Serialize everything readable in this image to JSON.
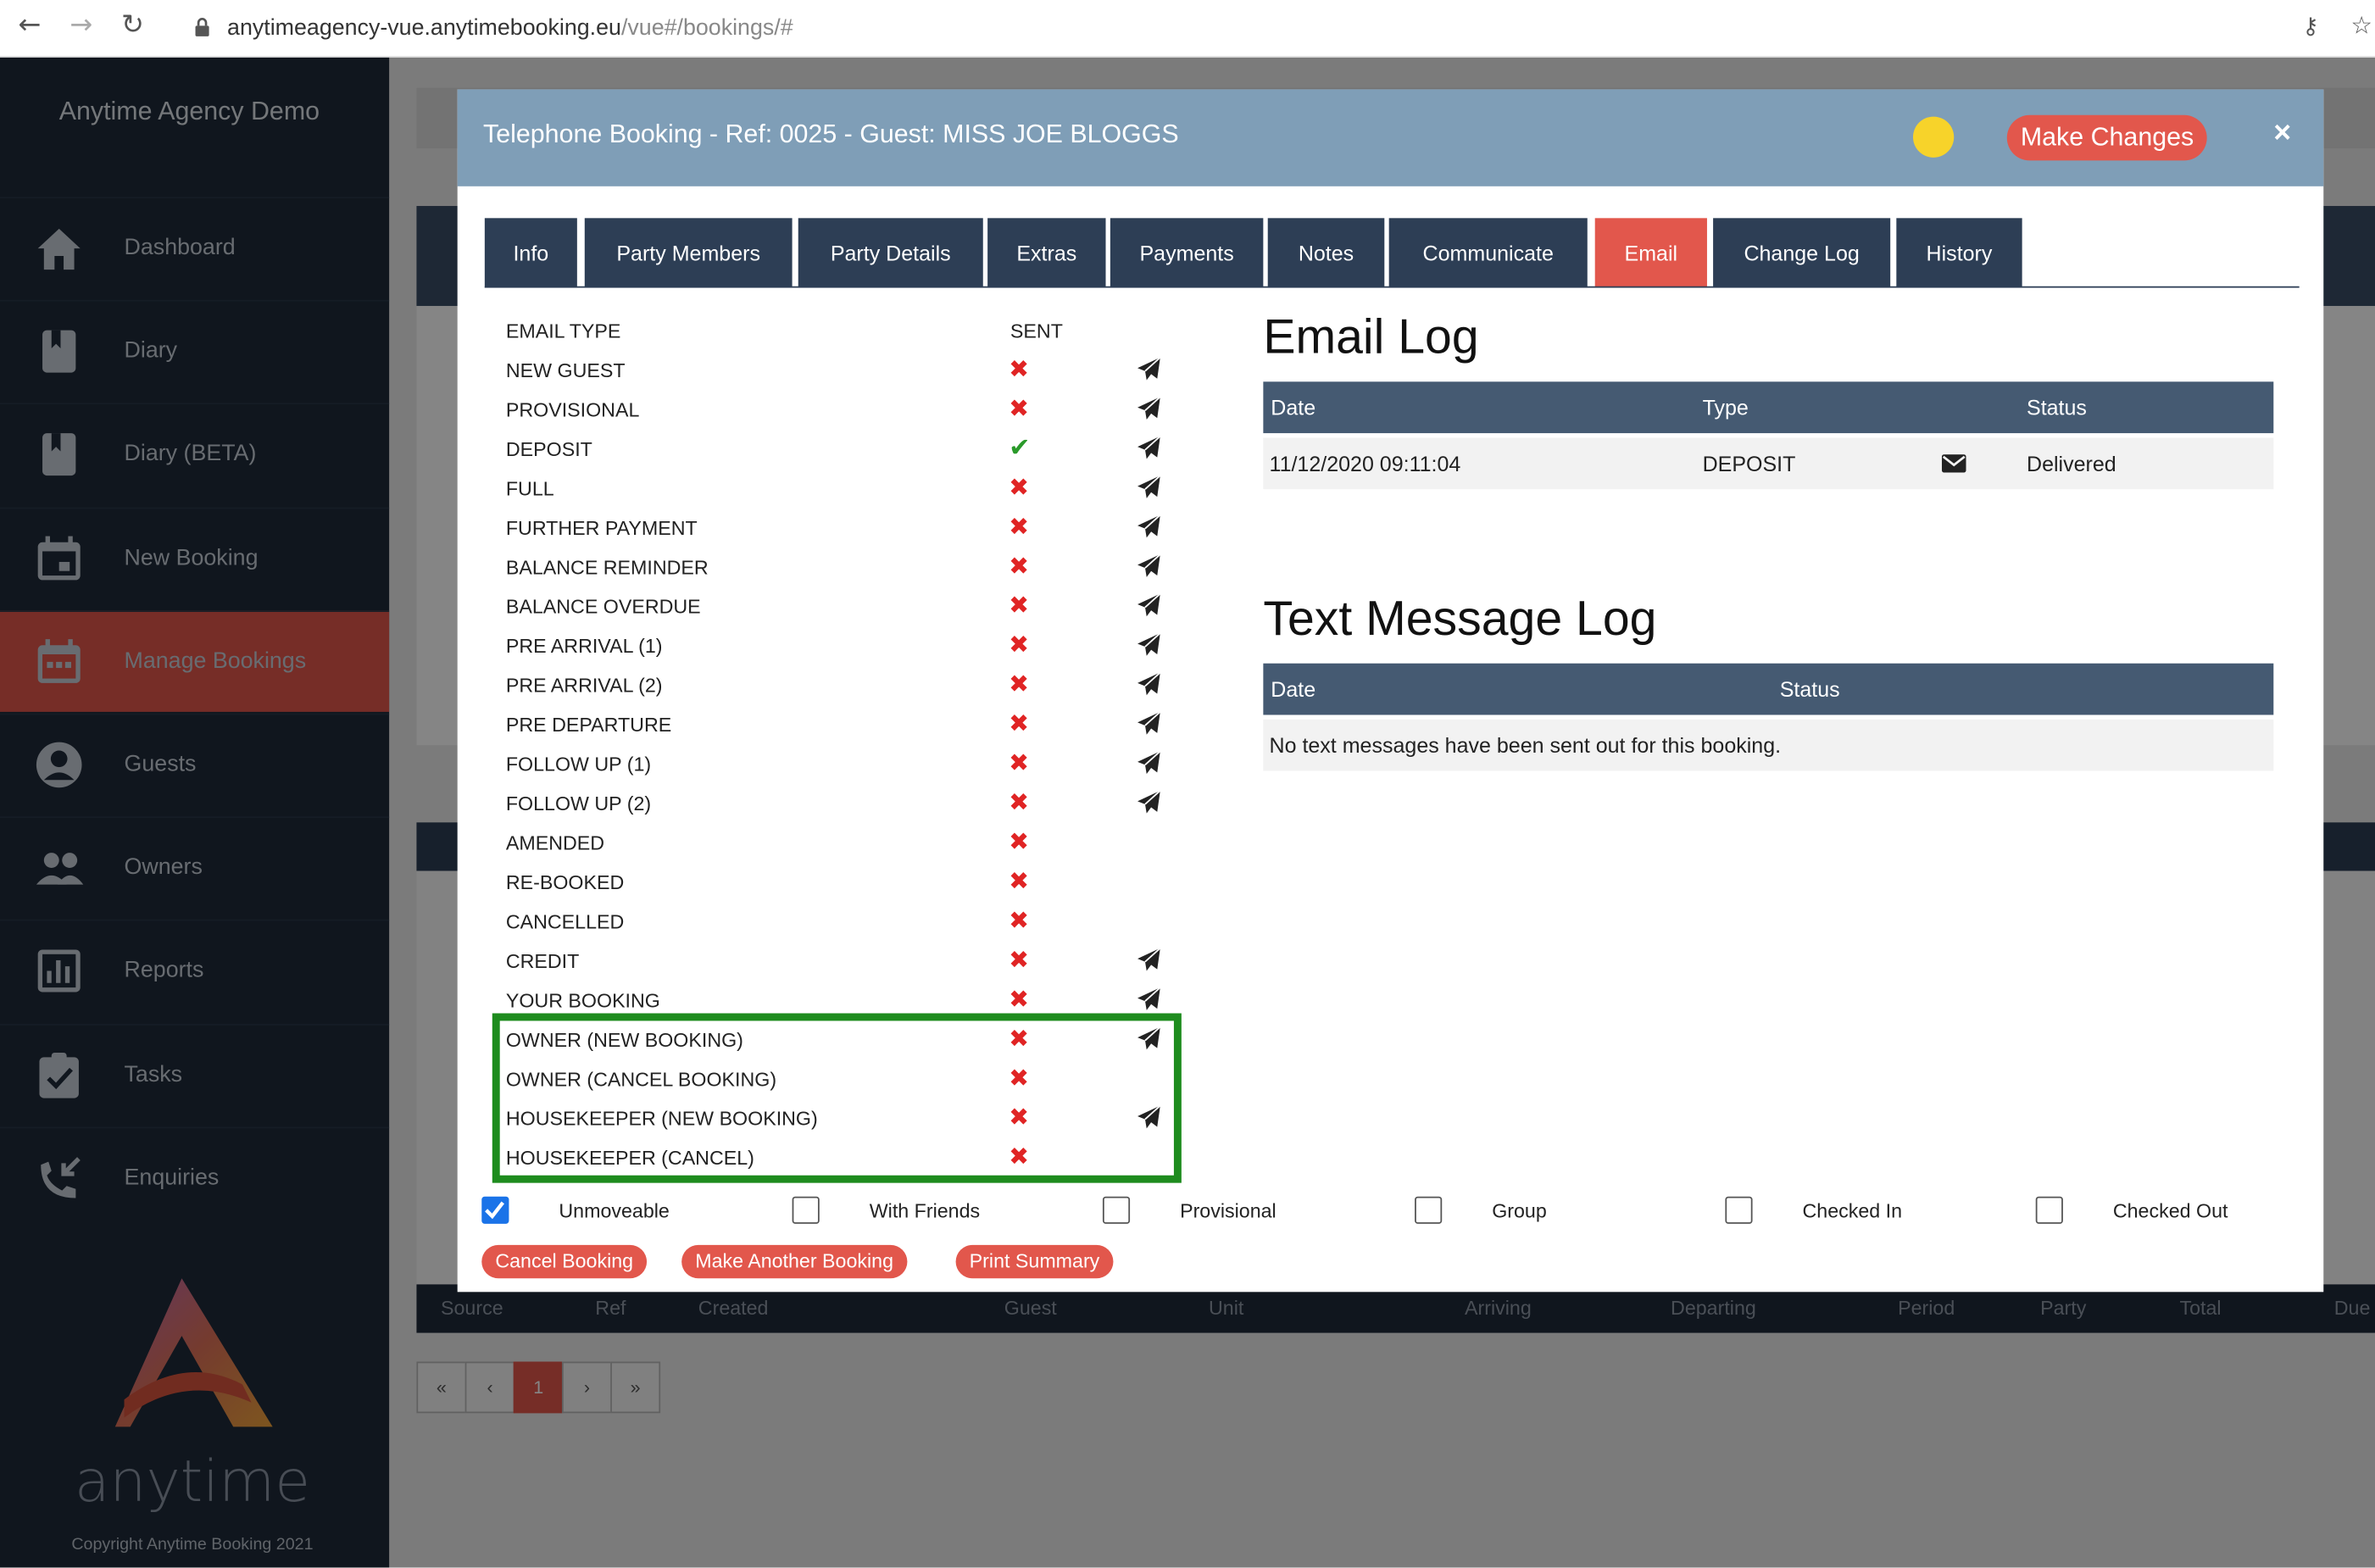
{
  "browser": {
    "url_host": "anytimeagency-vue.anytimebooking.eu",
    "url_path": "/vue#/bookings/#"
  },
  "sidebar": {
    "brand": "Anytime Agency Demo",
    "items": [
      {
        "label": "Dashboard",
        "icon": "home-icon"
      },
      {
        "label": "Diary",
        "icon": "bookmark-icon"
      },
      {
        "label": "Diary (BETA)",
        "icon": "bookmark-icon"
      },
      {
        "label": "New Booking",
        "icon": "calendar-icon"
      },
      {
        "label": "Manage Bookings",
        "icon": "calendar-dots-icon",
        "active": true
      },
      {
        "label": "Guests",
        "icon": "account-icon"
      },
      {
        "label": "Owners",
        "icon": "people-icon"
      },
      {
        "label": "Reports",
        "icon": "chart-icon"
      },
      {
        "label": "Tasks",
        "icon": "clipboard-check-icon"
      },
      {
        "label": "Enquiries",
        "icon": "phone-incoming-icon"
      }
    ],
    "logo_text": "anytime",
    "copyright": "Copyright Anytime Booking 2021"
  },
  "modal": {
    "title": "Telephone Booking - Ref: 0025 - Guest: MISS JOE BLOGGS",
    "make_changes": "Make Changes",
    "close": "×",
    "tabs": [
      "Info",
      "Party Members",
      "Party Details",
      "Extras",
      "Payments",
      "Notes",
      "Communicate",
      "Email",
      "Change Log",
      "History"
    ],
    "active_tab": "Email",
    "email_types_header": "EMAIL TYPE",
    "sent_header": "SENT",
    "email_types": [
      {
        "name": "NEW GUEST",
        "sent": false,
        "sendable": true
      },
      {
        "name": "PROVISIONAL",
        "sent": false,
        "sendable": true
      },
      {
        "name": "DEPOSIT",
        "sent": true,
        "sendable": true
      },
      {
        "name": "FULL",
        "sent": false,
        "sendable": true
      },
      {
        "name": "FURTHER PAYMENT",
        "sent": false,
        "sendable": true
      },
      {
        "name": "BALANCE REMINDER",
        "sent": false,
        "sendable": true
      },
      {
        "name": "BALANCE OVERDUE",
        "sent": false,
        "sendable": true
      },
      {
        "name": "PRE ARRIVAL (1)",
        "sent": false,
        "sendable": true
      },
      {
        "name": "PRE ARRIVAL (2)",
        "sent": false,
        "sendable": true
      },
      {
        "name": "PRE DEPARTURE",
        "sent": false,
        "sendable": true
      },
      {
        "name": "FOLLOW UP (1)",
        "sent": false,
        "sendable": true
      },
      {
        "name": "FOLLOW UP (2)",
        "sent": false,
        "sendable": true
      },
      {
        "name": "AMENDED",
        "sent": false,
        "sendable": false
      },
      {
        "name": "RE-BOOKED",
        "sent": false,
        "sendable": false
      },
      {
        "name": "CANCELLED",
        "sent": false,
        "sendable": false
      },
      {
        "name": "CREDIT",
        "sent": false,
        "sendable": true
      },
      {
        "name": "YOUR BOOKING",
        "sent": false,
        "sendable": true
      },
      {
        "name": "OWNER (NEW BOOKING)",
        "sent": false,
        "sendable": true
      },
      {
        "name": "OWNER (CANCEL BOOKING)",
        "sent": false,
        "sendable": false
      },
      {
        "name": "HOUSEKEEPER (NEW BOOKING)",
        "sent": false,
        "sendable": true
      },
      {
        "name": "HOUSEKEEPER (CANCEL)",
        "sent": false,
        "sendable": false
      }
    ],
    "email_log": {
      "title": "Email Log",
      "headers": [
        "Date",
        "Type",
        "Status"
      ],
      "rows": [
        {
          "date": "11/12/2020 09:11:04",
          "type": "DEPOSIT",
          "status": "Delivered"
        }
      ]
    },
    "sms_log": {
      "title": "Text Message Log",
      "headers": [
        "Date",
        "Status"
      ],
      "empty": "No text messages have been sent out for this booking."
    },
    "flags": [
      {
        "label": "Unmoveable",
        "checked": true
      },
      {
        "label": "With Friends",
        "checked": false
      },
      {
        "label": "Provisional",
        "checked": false
      },
      {
        "label": "Group",
        "checked": false
      },
      {
        "label": "Checked In",
        "checked": false
      },
      {
        "label": "Checked Out",
        "checked": false
      }
    ],
    "actions": [
      "Cancel Booking",
      "Make Another Booking",
      "Print Summary"
    ]
  },
  "background": {
    "columns": [
      "Source",
      "Ref",
      "Created",
      "Guest",
      "Unit",
      "Arriving",
      "Departing",
      "Period",
      "Party",
      "Total",
      "Due"
    ],
    "pagination": [
      "«",
      "‹",
      "1",
      "›",
      "»"
    ]
  },
  "colors": {
    "accent": "#e2574c",
    "sidebar": "#1f2b3a",
    "modal_header": "#7f9eb7",
    "tab": "#2d3e55",
    "highlight_box": "#1e8c1e"
  }
}
